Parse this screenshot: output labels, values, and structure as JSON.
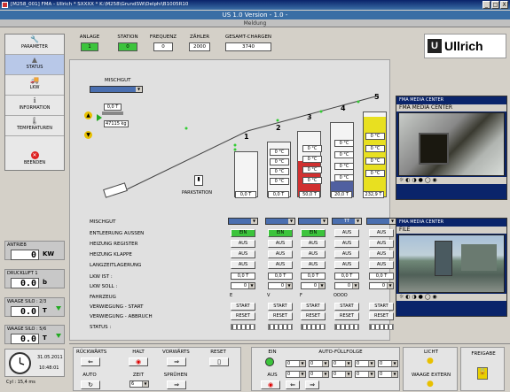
{
  "window": {
    "title": "[M258_001]    FMA - Ullrich   * SXXXX * K:\\M258\\GrundSW\\Delphi\\B1005R10",
    "buttons": [
      "_",
      "□",
      "X"
    ]
  },
  "version": "US 1.0   Version - 1.0 -",
  "meldung": "Meldung",
  "nav": [
    {
      "icon": "wrench-icon",
      "glyph": "🔧",
      "label": "PARAMETER"
    },
    {
      "icon": "status-icon",
      "glyph": "▲",
      "label": "STATUS"
    },
    {
      "icon": "truck-icon",
      "glyph": "🚚",
      "label": "LKW"
    },
    {
      "icon": "info-icon",
      "glyph": "ℹ",
      "label": "INFORMATION"
    },
    {
      "icon": "thermometer-icon",
      "glyph": "🌡",
      "label": "TEMPERATUREN"
    },
    {
      "icon": "exit-icon",
      "glyph": "✕",
      "label": "BEENDEN"
    }
  ],
  "side": {
    "antrieb": {
      "label": "ANTRIEB",
      "value": "0",
      "unit": "KW"
    },
    "druckluft": {
      "label": "DRUCKLUFT 1",
      "value": "0.0",
      "unit": "b"
    },
    "waage23": {
      "label": "WAAGE SILO : 2/3",
      "value": "0.0",
      "unit": "T"
    },
    "waage56": {
      "label": "WAAGE SILO : 5/6",
      "value": "0.0",
      "unit": "T"
    }
  },
  "clock": {
    "date": "31.05.2011",
    "time": "10:48:01"
  },
  "cyl": "Cyl : 15,4 ms",
  "header": {
    "anlage": {
      "label": "ANLAGE",
      "value": "1"
    },
    "station": {
      "label": "STATION",
      "value": "0"
    },
    "frequenz": {
      "label": "FREQUENZ",
      "value": "0"
    },
    "zaehler": {
      "label": "ZÄHLER",
      "value": "2000"
    },
    "gesamt": {
      "label": "GESAMT-CHARGEN",
      "value": "3740"
    }
  },
  "logo": {
    "mark": "U",
    "text": "Ullrich"
  },
  "mischgut_top": {
    "label": "MISCHGUT",
    "value": "",
    "weight": "0,0 T",
    "scale": "47115 kg"
  },
  "parkstation": "PARKSTATION",
  "silos": [
    {
      "num": "1",
      "temps": [],
      "value": "0,0 T",
      "fill": 0,
      "color": "#bbb"
    },
    {
      "num": "2",
      "temps": [
        "0 °C",
        "0 °C",
        "0 °C",
        "0 °C"
      ],
      "value": "0,0 T",
      "fill": 0,
      "color": "#bbb"
    },
    {
      "num": "3",
      "temps": [
        "0 °C",
        "0 °C",
        "0 °C",
        "0 °C"
      ],
      "value": "50,0 T",
      "fill": 0.55,
      "color": "#d03030"
    },
    {
      "num": "4",
      "temps": [
        "0 °C",
        "0 °C",
        "0 °C",
        "0 °C"
      ],
      "value": "20,0 T",
      "fill": 0.2,
      "color": "#5060a0"
    },
    {
      "num": "5",
      "temps": [
        "0 °C",
        "0 °C",
        "0 °C",
        "0 °C"
      ],
      "value": "232,9 T",
      "fill": 0.95,
      "color": "#e8e020"
    }
  ],
  "rows": {
    "mischgut": "MISCHGUT",
    "entleerung": "ENTLEERUNG AUSSEN",
    "heizreg": "HEIZUNG REGISTER",
    "heizklappe": "HEIZUNG KLAPPE",
    "langzeit": "LANGZEITLAGERUNG",
    "lkwist": "LKW IST :",
    "lkwsoll": "LKW SOLL :",
    "fahrzeug": "FAHRZEUG",
    "verwstart": "VERWIEGUNG - START",
    "verwabbruch": "VERWIEGUNG - ABBRUCH",
    "status": "STATUS :"
  },
  "grid": {
    "mischgut": [
      "",
      "",
      "",
      "TT",
      ""
    ],
    "entleerung": [
      "EIN",
      "EIN",
      "EIN",
      "AUS",
      "AUS"
    ],
    "heizreg": [
      "AUS",
      "AUS",
      "AUS",
      "AUS",
      "AUS"
    ],
    "heizklappe": [
      "AUS",
      "AUS",
      "AUS",
      "AUS",
      "AUS"
    ],
    "langzeit": [
      "AUS",
      "AUS",
      "AUS",
      "AUS",
      "AUS"
    ],
    "lkwist": [
      "0,0 T",
      "0,0 T",
      "0,0 T",
      "0,0 T",
      "0,0 T"
    ],
    "lkwsoll": [
      "0",
      "0",
      "0",
      "0",
      "0"
    ],
    "fahrzeug": [
      "E",
      "V",
      "F",
      "OOOO",
      ""
    ],
    "verwstart": [
      "START",
      "START",
      "START",
      "START",
      "START"
    ],
    "verwabbruch": [
      "RESET",
      "RESET",
      "RESET",
      "RESET",
      "RESET"
    ]
  },
  "cam1": {
    "title": "FMA MEDIA CENTER",
    "inner": "FMA MEDIA CENTER"
  },
  "cam2": {
    "title": "FMA MEDIA CENTER",
    "file": "FILE"
  },
  "bottom": {
    "rueck": "RÜCKWÄRTS",
    "halt": "HALT",
    "vor": "VORWÄRTS",
    "reset": "RESET",
    "auto": "AUTO",
    "zeit": "ZEIT",
    "zeitval": "6",
    "spruehen": "SPRÜHEN",
    "ein": "EIN",
    "aus": "AUS",
    "autofuell": "AUTO-FÜLLFOLGE",
    "fuell": [
      "0",
      "0",
      "0",
      "0",
      "0",
      "0",
      "0",
      "0",
      "0",
      "0"
    ],
    "licht": "LICHT",
    "waage": "WAAGE EXTERN",
    "freigabe": "FREIGABE"
  }
}
